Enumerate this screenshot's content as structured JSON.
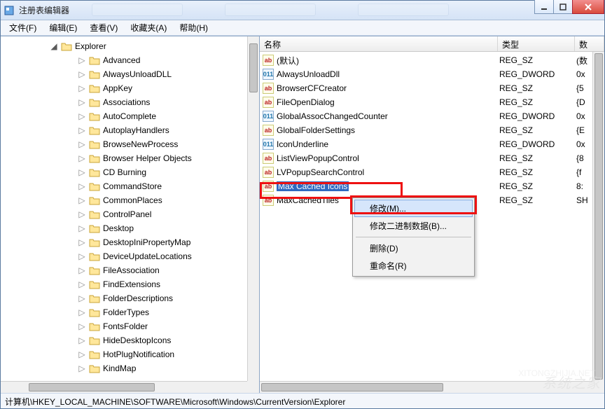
{
  "window": {
    "title": "注册表编辑器"
  },
  "menu": {
    "file": "文件(F)",
    "edit": "编辑(E)",
    "view": "查看(V)",
    "favorites": "收藏夹(A)",
    "help": "帮助(H)"
  },
  "tree": {
    "parent": "Explorer",
    "items": [
      "Advanced",
      "AlwaysUnloadDLL",
      "AppKey",
      "Associations",
      "AutoComplete",
      "AutoplayHandlers",
      "BrowseNewProcess",
      "Browser Helper Objects",
      "CD Burning",
      "CommandStore",
      "CommonPlaces",
      "ControlPanel",
      "Desktop",
      "DesktopIniPropertyMap",
      "DeviceUpdateLocations",
      "FileAssociation",
      "FindExtensions",
      "FolderDescriptions",
      "FolderTypes",
      "FontsFolder",
      "HideDesktopIcons",
      "HotPlugNotification",
      "KindMap"
    ]
  },
  "listcols": {
    "name": "名称",
    "type": "类型",
    "data": "数"
  },
  "values": [
    {
      "icon": "sz",
      "name": "(默认)",
      "type": "REG_SZ",
      "data": "(数"
    },
    {
      "icon": "bin",
      "name": "AlwaysUnloadDll",
      "type": "REG_DWORD",
      "data": "0x"
    },
    {
      "icon": "sz",
      "name": "BrowserCFCreator",
      "type": "REG_SZ",
      "data": "{5"
    },
    {
      "icon": "sz",
      "name": "FileOpenDialog",
      "type": "REG_SZ",
      "data": "{D"
    },
    {
      "icon": "bin",
      "name": "GlobalAssocChangedCounter",
      "type": "REG_DWORD",
      "data": "0x"
    },
    {
      "icon": "sz",
      "name": "GlobalFolderSettings",
      "type": "REG_SZ",
      "data": "{E"
    },
    {
      "icon": "bin",
      "name": "IconUnderline",
      "type": "REG_DWORD",
      "data": "0x"
    },
    {
      "icon": "sz",
      "name": "ListViewPopupControl",
      "type": "REG_SZ",
      "data": "{8"
    },
    {
      "icon": "sz",
      "name": "LVPopupSearchControl",
      "type": "REG_SZ",
      "data": "{f"
    },
    {
      "icon": "sz",
      "name": "Max Cached Icons",
      "type": "REG_SZ",
      "data": "8:",
      "selected": true
    },
    {
      "icon": "sz",
      "name": "MaxCachedTiles",
      "type": "REG_SZ",
      "data": "SH"
    }
  ],
  "context_menu": {
    "modify": "修改(M)...",
    "modify_binary": "修改二进制数据(B)...",
    "delete": "删除(D)",
    "rename": "重命名(R)"
  },
  "statusbar": "计算机\\HKEY_LOCAL_MACHINE\\SOFTWARE\\Microsoft\\Windows\\CurrentVersion\\Explorer",
  "watermark_main": "系统之家",
  "watermark_sub": "XITONGZHIJIA.NET"
}
